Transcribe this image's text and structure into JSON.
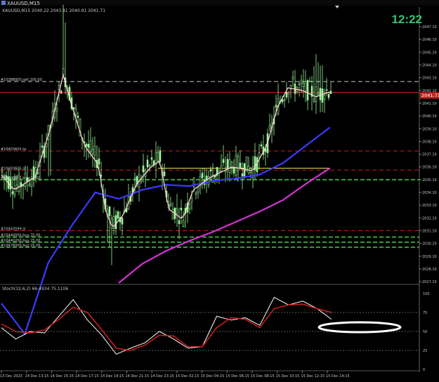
{
  "window": {
    "tab_title": "XAUUSD,M15",
    "ohlc_header": "XAUUSD,M15  2040.22 2043.81 2040.91 2041.71",
    "clock": "12:22"
  },
  "price_panel": {
    "ymin": 2027.0,
    "ymax": 2048.2,
    "ticks": [
      {
        "label": "2047.10",
        "v": 2047.1
      },
      {
        "label": "2046.10",
        "v": 2046.1
      },
      {
        "label": "2045.10",
        "v": 2045.1
      },
      {
        "label": "2044.10",
        "v": 2044.1
      },
      {
        "label": "2043.10",
        "v": 2043.1
      },
      {
        "label": "2042.10",
        "v": 2042.1
      },
      {
        "label": "2041.10",
        "v": 2041.1
      },
      {
        "label": "2040.10",
        "v": 2040.1
      },
      {
        "label": "2039.10",
        "v": 2039.1
      },
      {
        "label": "2038.10",
        "v": 2038.1
      },
      {
        "label": "2037.10",
        "v": 2037.1
      },
      {
        "label": "2036.10",
        "v": 2036.1
      },
      {
        "label": "2035.10",
        "v": 2035.1
      },
      {
        "label": "2034.10",
        "v": 2034.1
      },
      {
        "label": "2033.10",
        "v": 2033.1
      },
      {
        "label": "2032.10",
        "v": 2032.1
      },
      {
        "label": "2031.10",
        "v": 2031.1
      },
      {
        "label": "2030.10",
        "v": 2030.1
      },
      {
        "label": "2029.10",
        "v": 2029.1
      },
      {
        "label": "2028.10",
        "v": 2028.1
      },
      {
        "label": "2027.10",
        "v": 2027.1
      }
    ],
    "current_price_label": "2041.71",
    "current_price": 2041.71,
    "order_lines": [
      {
        "label": "#10388000 sell 200.00",
        "v": 2042.8,
        "color": "#c8c8c8"
      },
      {
        "label": "",
        "v": 2041.95,
        "color": "#c82020"
      },
      {
        "label": "#10403605 tp",
        "v": 2037.35,
        "color": "#c82020"
      },
      {
        "label": "#10403605 sl",
        "v": 2035.85,
        "color": "#c82020"
      },
      {
        "label": "#10403605 buy 25.00",
        "v": 2035.1,
        "color": "#3aa03a"
      },
      {
        "label": "#10443599 sl",
        "v": 2031.1,
        "color": "#c82020"
      },
      {
        "label": "#10440000 buy 25.00",
        "v": 2030.6,
        "color": "#3aa03a"
      },
      {
        "label": "#10440200 buy 25.00",
        "v": 2030.2,
        "color": "#3aa03a"
      },
      {
        "label": "#10478000 buy 25.00",
        "v": 2029.8,
        "color": "#3aa03a"
      }
    ],
    "hline_yellow": 2036.0,
    "hline_red_top": 2041.95
  },
  "chart_data": [
    {
      "type": "line",
      "title": "XAUUSD,M15",
      "x_labels": [
        "13 Dec 2023",
        "14 Dec 13:15",
        "14 Dec 15:15",
        "14 Dec 17:15",
        "14 Dec 19:15",
        "14 Dec 21:15",
        "14 Dec 23:15",
        "15 Dec 02:15",
        "15 Dec 04:15",
        "15 Dec 06:15",
        "15 Dec 08:15",
        "15 Dec 10:15",
        "15 Dec 12:15",
        "15 Dec 14:15"
      ],
      "x": [
        0,
        14,
        28,
        42,
        56,
        70,
        84,
        98,
        112,
        126,
        140,
        154,
        168,
        182
      ],
      "series": [
        {
          "name": "",
          "color": "#3a3aff",
          "values": [
            2025.4,
            2023.0,
            2028.6,
            2031.5,
            2034.1,
            2033.6,
            2034.3,
            2034.7,
            2034.6,
            2035.0,
            2035.2,
            2035.5,
            2036.4,
            2037.8,
            2039.2
          ]
        },
        {
          "name": "",
          "color": "#d432d4",
          "values": [
            null,
            null,
            null,
            null,
            null,
            2027.0,
            2028.5,
            2029.5,
            2030.3,
            2031.0,
            2031.8,
            2032.6,
            2033.5,
            2034.8,
            2036.0
          ]
        }
      ],
      "ylim": [
        2027.0,
        2048.2
      ]
    },
    {
      "type": "line",
      "title": "Stoch(32,6,2) 66.4934 75.1106",
      "ylim": [
        0,
        100
      ],
      "yticks": [
        "100",
        "75",
        "50",
        "25",
        "0"
      ],
      "series": [
        {
          "name": "",
          "color": "#ffffff",
          "values": [
            55,
            40,
            50,
            48,
            70,
            92,
            65,
            45,
            20,
            28,
            35,
            50,
            40,
            28,
            30,
            70,
            65,
            68,
            58,
            95,
            85,
            90,
            80,
            66
          ]
        },
        {
          "name": "",
          "color": "#d02020",
          "values": [
            60,
            50,
            48,
            52,
            66,
            82,
            75,
            52,
            28,
            25,
            32,
            45,
            44,
            30,
            30,
            55,
            68,
            66,
            55,
            80,
            85,
            86,
            80,
            75
          ]
        }
      ]
    }
  ],
  "stoch_panel": {
    "header": "Stoch(32,6,2) 66.4934 75.1106",
    "ticks": [
      "100",
      "75",
      "50",
      "25",
      "0"
    ]
  },
  "icons": {
    "window_icon": "chart-window-icon",
    "scroll_marker": "scroll-triangle-icon"
  }
}
